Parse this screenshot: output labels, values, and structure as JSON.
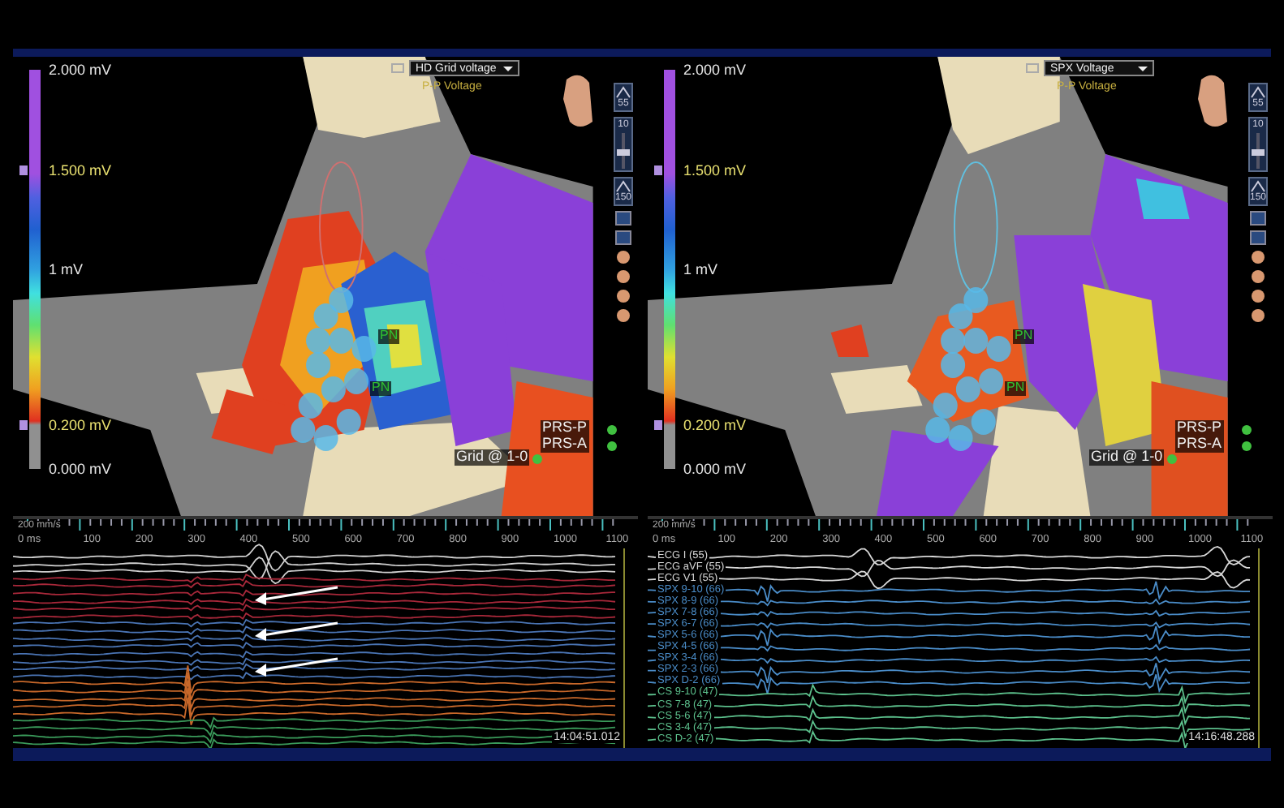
{
  "panels": [
    {
      "map": {
        "dropdown": "HD Grid voltage",
        "map_type": "P-P Voltage",
        "scale": [
          {
            "text": "2.000 mV",
            "marker": false
          },
          {
            "text": "1.500 mV",
            "marker": true
          },
          {
            "text": "1 mV",
            "marker": false
          },
          {
            "text": "0.200 mV",
            "marker": true
          },
          {
            "text": "0.000 mV",
            "marker": false
          }
        ],
        "labels": [
          {
            "text": "PN",
            "kind": "catheter"
          },
          {
            "text": "PN",
            "kind": "catheter"
          },
          {
            "text": "PRS-P",
            "kind": "point"
          },
          {
            "text": "PRS-A",
            "kind": "point"
          },
          {
            "text": "Grid @ 1-0",
            "kind": "grid"
          }
        ],
        "toolbar": [
          {
            "kind": "button",
            "text": "55"
          },
          {
            "kind": "slider",
            "text": "10",
            "level": 0.45
          },
          {
            "kind": "button",
            "text": "150"
          }
        ]
      },
      "egm": {
        "speed": "200 mm/s",
        "origin": "0 ms",
        "ticks": [
          "100",
          "200",
          "300",
          "400",
          "500",
          "600",
          "700",
          "800",
          "900",
          "1000",
          "1100"
        ],
        "timestamp": "14:04:51.012",
        "channels": [
          {
            "kind": "ecg",
            "color": "#d0d0d0"
          },
          {
            "kind": "ecg",
            "color": "#d0d0d0"
          },
          {
            "kind": "ecg",
            "color": "#d0d0d0"
          },
          {
            "kind": "red",
            "color": "#a8283a"
          },
          {
            "kind": "red",
            "color": "#a8283a"
          },
          {
            "kind": "red",
            "color": "#a8283a"
          },
          {
            "kind": "red",
            "color": "#a8283a"
          },
          {
            "kind": "red",
            "color": "#a8283a"
          },
          {
            "kind": "red",
            "color": "#a8283a"
          },
          {
            "kind": "blue",
            "color": "#4a74b4"
          },
          {
            "kind": "blue",
            "color": "#4a74b4"
          },
          {
            "kind": "blue",
            "color": "#4a74b4"
          },
          {
            "kind": "blue",
            "color": "#4a74b4"
          },
          {
            "kind": "blue",
            "color": "#4a74b4"
          },
          {
            "kind": "blue",
            "color": "#4a74b4"
          },
          {
            "kind": "blue",
            "color": "#4a74b4"
          },
          {
            "kind": "blue",
            "color": "#4a74b4"
          },
          {
            "kind": "orange",
            "color": "#c8682a"
          },
          {
            "kind": "orange",
            "color": "#c8682a"
          },
          {
            "kind": "orange",
            "color": "#c8682a"
          },
          {
            "kind": "orange",
            "color": "#c8682a"
          },
          {
            "kind": "orange",
            "color": "#c8682a"
          },
          {
            "kind": "cs",
            "color": "#3a9a5a"
          },
          {
            "kind": "cs",
            "color": "#3a9a5a"
          },
          {
            "kind": "cs",
            "color": "#3a9a5a"
          },
          {
            "kind": "cs",
            "color": "#3a9a5a"
          }
        ]
      }
    },
    {
      "map": {
        "dropdown": "SPX Voltage",
        "map_type": "P-P Voltage",
        "scale": [
          {
            "text": "2.000 mV",
            "marker": false
          },
          {
            "text": "1.500 mV",
            "marker": true
          },
          {
            "text": "1 mV",
            "marker": false
          },
          {
            "text": "0.200 mV",
            "marker": true
          },
          {
            "text": "0.000 mV",
            "marker": false
          }
        ],
        "labels": [
          {
            "text": "PN",
            "kind": "catheter"
          },
          {
            "text": "PN",
            "kind": "catheter"
          },
          {
            "text": "PRS-P",
            "kind": "point"
          },
          {
            "text": "PRS-A",
            "kind": "point"
          },
          {
            "text": "Grid @ 1-0",
            "kind": "grid"
          }
        ],
        "toolbar": [
          {
            "kind": "button",
            "text": "55"
          },
          {
            "kind": "slider",
            "text": "10",
            "level": 0.45
          },
          {
            "kind": "button",
            "text": "150"
          }
        ]
      },
      "egm": {
        "speed": "200 mm/s",
        "origin": "0 ms",
        "ticks": [
          "100",
          "200",
          "300",
          "400",
          "500",
          "600",
          "700",
          "800",
          "900",
          "1000",
          "1100"
        ],
        "timestamp": "14:16:48.288",
        "channels": [
          {
            "kind": "ecg",
            "color": "#d8d8d8",
            "label": "ECG I (55)"
          },
          {
            "kind": "ecg",
            "color": "#d8d8d8",
            "label": "ECG aVF (55)"
          },
          {
            "kind": "ecg",
            "color": "#d8d8d8",
            "label": "ECG V1 (55)"
          },
          {
            "kind": "spx",
            "color": "#4a8cc8",
            "label": "SPX 9-10 (66)"
          },
          {
            "kind": "spx",
            "color": "#4a8cc8",
            "label": "SPX 8-9 (66)"
          },
          {
            "kind": "spx",
            "color": "#4a8cc8",
            "label": "SPX 7-8 (66)"
          },
          {
            "kind": "spx",
            "color": "#4a8cc8",
            "label": "SPX 6-7 (66)"
          },
          {
            "kind": "spx",
            "color": "#4a8cc8",
            "label": "SPX 5-6 (66)"
          },
          {
            "kind": "spx",
            "color": "#4a8cc8",
            "label": "SPX 4-5 (66)"
          },
          {
            "kind": "spx",
            "color": "#4a8cc8",
            "label": "SPX 3-4 (66)"
          },
          {
            "kind": "spx",
            "color": "#4a8cc8",
            "label": "SPX 2-3 (66)"
          },
          {
            "kind": "spx",
            "color": "#4a8cc8",
            "label": "SPX D-2 (66)"
          },
          {
            "kind": "cs",
            "color": "#5cc08c",
            "label": "CS 9-10 (47)"
          },
          {
            "kind": "cs",
            "color": "#5cc08c",
            "label": "CS 7-8 (47)"
          },
          {
            "kind": "cs",
            "color": "#5cc08c",
            "label": "CS 5-6 (47)"
          },
          {
            "kind": "cs",
            "color": "#5cc08c",
            "label": "CS 3-4 (47)"
          },
          {
            "kind": "cs",
            "color": "#5cc08c",
            "label": "CS D-2 (47)"
          }
        ]
      }
    }
  ]
}
